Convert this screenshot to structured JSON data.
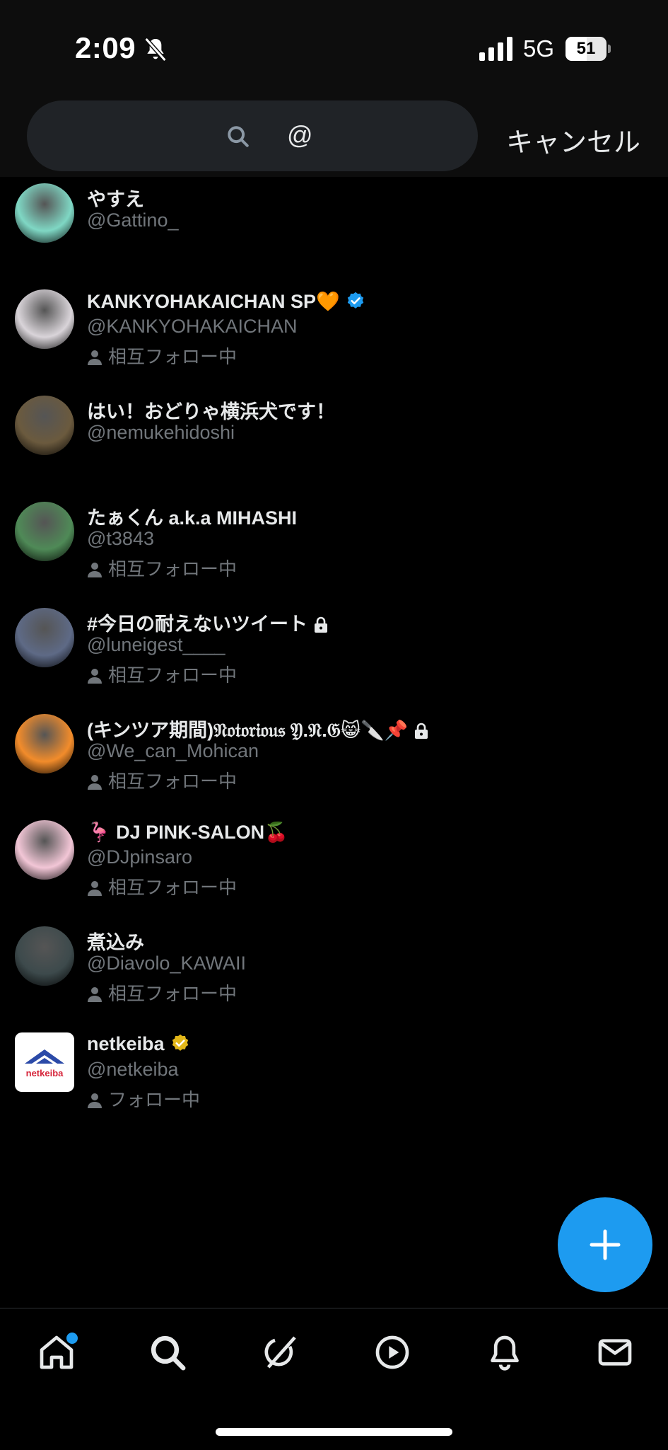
{
  "status_bar": {
    "time": "2:09",
    "network": "5G",
    "battery": "51",
    "battery_level_percent": 51
  },
  "search": {
    "value": "@",
    "cancel_label": "キャンセル"
  },
  "results": [
    {
      "name": "やすえ",
      "handle": "@Gattino_",
      "follow_status": "",
      "badges": [],
      "avatar_color": "#7fd7c4"
    },
    {
      "name": "KANKYOHAKAICHAN SP🧡",
      "handle": "@KANKYOHAKAICHAN",
      "follow_status": "相互フォロー中",
      "badges": [
        "verified-blue-icon"
      ],
      "avatar_color": "#d9d4d9"
    },
    {
      "name": "はい！おどりゃ横浜犬です！",
      "handle": "@nemukehidoshi",
      "follow_status": "",
      "badges": [],
      "avatar_color": "#6b5a3e"
    },
    {
      "name": "たぁくん a.k.a MIHASHI",
      "handle": "@t3843",
      "follow_status": "相互フォロー中",
      "badges": [],
      "avatar_color": "#4f8a57"
    },
    {
      "name": "#今日の耐えないツイート",
      "handle": "@luneigest____",
      "follow_status": "相互フォロー中",
      "badges": [
        "lock-icon"
      ],
      "avatar_color": "#5e6a86"
    },
    {
      "name": "(キンツア期間)𝔑𝔬𝔱𝔬𝔯𝔦𝔬𝔲𝔰 𝔜.𝔑.𝔊😸🔪📌",
      "handle": "@We_can_Mohican",
      "follow_status": "相互フォロー中",
      "badges": [
        "lock-icon"
      ],
      "avatar_color": "#f28c2b"
    },
    {
      "name": "🦩 DJ PINK-SALON🍒",
      "handle": "@DJpinsaro",
      "follow_status": "相互フォロー中",
      "badges": [],
      "avatar_color": "#f2c6d6"
    },
    {
      "name": "煮込み",
      "handle": "@Diavolo_KAWAII",
      "follow_status": "相互フォロー中",
      "badges": [],
      "avatar_color": "#3d4a4c"
    },
    {
      "name": "netkeiba",
      "handle": "@netkeiba",
      "follow_status": "フォロー中",
      "badges": [
        "verified-gold-icon"
      ],
      "avatar_logo_text": "netkeiba",
      "avatar_color": "#ffffff"
    }
  ],
  "tab_bar": {
    "items": [
      "home-icon",
      "search-icon",
      "grok-icon",
      "video-icon",
      "notifications-icon",
      "messages-icon"
    ]
  },
  "colors": {
    "accent": "#1d9bf0",
    "secondary_text": "#71767b",
    "gold": "#e2b719"
  }
}
